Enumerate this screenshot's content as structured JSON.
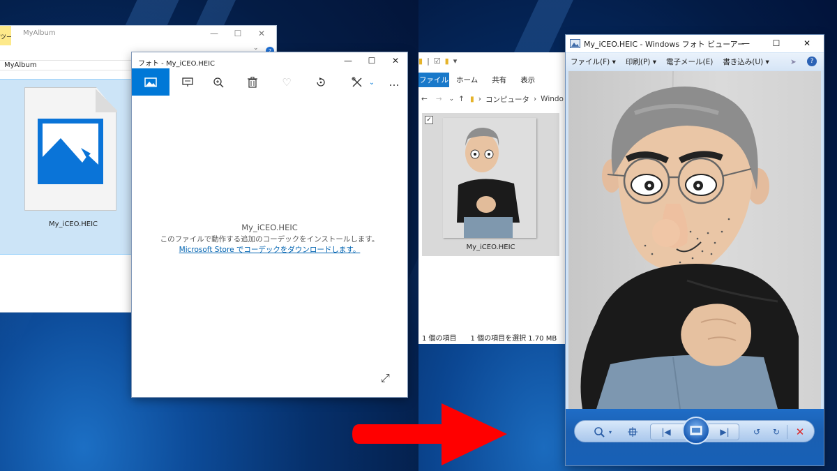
{
  "back_explorer": {
    "tool_tab": "ツール",
    "title": "MyAlbum",
    "address": "MyAlbum",
    "file_name": "My_iCEO.HEIC"
  },
  "photos_app": {
    "title": "フォト - My_iCEO.HEIC",
    "file_name": "My_iCEO.HEIC",
    "message": "このファイルで動作する追加のコーデックをインストールします。",
    "link": "Microsoft Store でコーデックをダウンロードします。",
    "more": "…"
  },
  "explorer": {
    "tabs": [
      "ファイル",
      "ホーム",
      "共有",
      "表示"
    ],
    "breadcrumb": "コンピュータ",
    "breadcrumb_next": "Windo",
    "file_name": "My_iCEO.HEIC",
    "status_count": "1 個の項目",
    "status_selected": "1 個の項目を選択  1.70 MB"
  },
  "viewer": {
    "title": "My_iCEO.HEIC - Windows フォト ビューアー",
    "menu": [
      "ファイル(F)",
      "印刷(P)",
      "電子メール(E)",
      "書き込み(U)"
    ],
    "help": "?"
  },
  "colors": {
    "accent": "#0078d7",
    "arrow": "#ff0000"
  }
}
